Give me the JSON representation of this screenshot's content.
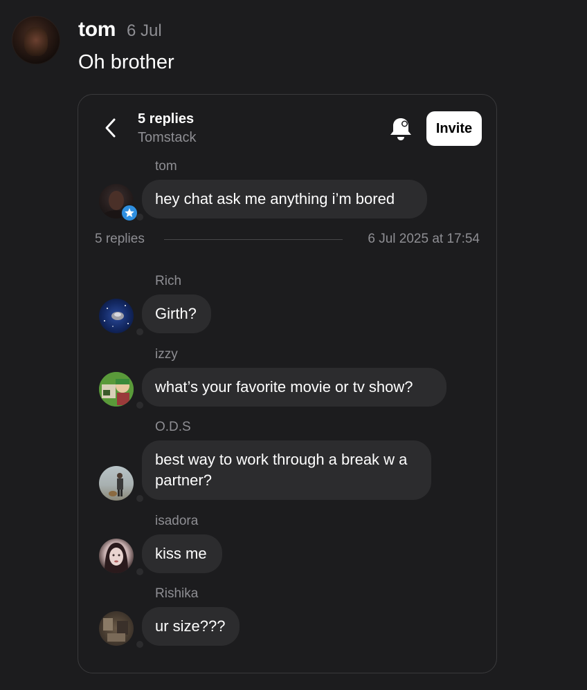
{
  "post": {
    "author": "tom",
    "date": "6 Jul",
    "text": "Oh brother"
  },
  "thread": {
    "count_label": "5 replies",
    "channel": "Tomstack",
    "invite_label": "Invite",
    "original": {
      "name": "tom",
      "text": "hey chat ask me anything i’m bored"
    },
    "divider": {
      "replies": "5 replies",
      "timestamp": "6 Jul 2025 at 17:54"
    },
    "replies": [
      {
        "name": "Rich",
        "text": "Girth?"
      },
      {
        "name": "izzy",
        "text": "what’s your favorite movie or tv show?"
      },
      {
        "name": "O.D.S",
        "text": "best way to work through a break w a partner?"
      },
      {
        "name": "isadora",
        "text": "kiss me"
      },
      {
        "name": "Rishika",
        "text": "ur size???"
      }
    ]
  },
  "colors": {
    "background": "#1c1c1e",
    "bubble": "#2c2c2e",
    "muted_text": "#8e8e93",
    "badge": "#2f8fe0",
    "card_border": "#3a3a3c"
  },
  "icons": {
    "back": "chevron-left-icon",
    "bell": "bell-icon",
    "badge": "star-badge-icon"
  }
}
